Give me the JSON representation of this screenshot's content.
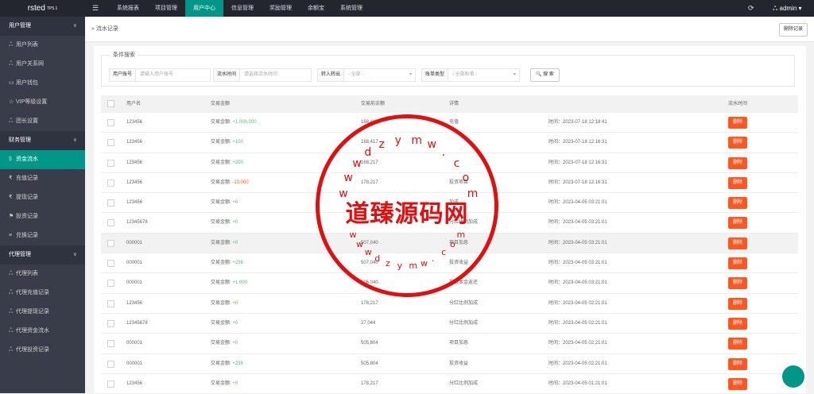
{
  "header": {
    "brand": "rsted",
    "brand_sup": "TP5.1",
    "menu_icon": "☰",
    "nav": [
      "系统报表",
      "项目管理",
      "用户中心",
      "信息管理",
      "奖励管理",
      "余额宝",
      "系统管理"
    ],
    "active_nav": "用户中心",
    "refresh_icon": "⟳",
    "user": "ஃ admin ▾"
  },
  "sidebar": {
    "groups": [
      {
        "title": "用户管理",
        "items": [
          {
            "icon": "ஃ",
            "label": "用户列表"
          },
          {
            "icon": "ஃ",
            "label": "用户关系网"
          },
          {
            "icon": "▭",
            "label": "用户钱包"
          },
          {
            "icon": "☆",
            "label": "VIP等级设置"
          },
          {
            "icon": "ஃ",
            "label": "团长设置"
          }
        ]
      },
      {
        "title": "财务管理",
        "items": [
          {
            "icon": "$",
            "label": "资金流水"
          },
          {
            "icon": "₹",
            "label": "充值记录"
          },
          {
            "icon": "₹",
            "label": "提现记录"
          },
          {
            "icon": "⚑",
            "label": "投资记录"
          },
          {
            "icon": "≡",
            "label": "兑换记录"
          }
        ]
      },
      {
        "title": "代理管理",
        "items": [
          {
            "icon": "ஃ",
            "label": "代理列表"
          },
          {
            "icon": "ஃ",
            "label": "代理充值记录"
          },
          {
            "icon": "ஃ",
            "label": "代理提现记录"
          },
          {
            "icon": "ஃ",
            "label": "代理资金流水"
          },
          {
            "icon": "ஃ",
            "label": "代理投资记录"
          }
        ]
      }
    ],
    "chevron": "∨",
    "active_item": "资金流水"
  },
  "tab": {
    "breadcrumb": "» 流水记录",
    "delete_label": "删除记录"
  },
  "filter": {
    "legend": "条件搜索",
    "fields": [
      {
        "label": "用户账号",
        "placeholder": "请输入用户账号"
      },
      {
        "label": "流水时间",
        "placeholder": "请选择流水时间"
      },
      {
        "label": "转入转出",
        "placeholder": "- 全部 -"
      },
      {
        "label": "账单类型",
        "placeholder": "- 全部账单 -"
      }
    ],
    "dropdown_icon": "▾",
    "search_label": "🔍 搜 索"
  },
  "table": {
    "headers": [
      "用户名",
      "交易金额",
      "交易前余额",
      "详情",
      "流水时间"
    ],
    "delete_label": "删除",
    "rows": [
      {
        "user": "123456",
        "prefix": "交易金额:",
        "amount": "+1,000,000",
        "before": "168,417",
        "detail": "充值",
        "time": "时间：2023-07-18 12:18:41",
        "has_delete": true,
        "neg": false
      },
      {
        "user": "123456",
        "prefix": "交易金额:",
        "amount": "+100",
        "before": "168,417",
        "detail": "",
        "time": "时间：2023-07-18 12:16:31",
        "has_delete": true,
        "neg": false
      },
      {
        "user": "123456",
        "prefix": "交易金额:",
        "amount": "+200",
        "before": "168,217",
        "detail": "",
        "time": "时间：2023-07-18 12:16:31",
        "has_delete": true,
        "neg": false
      },
      {
        "user": "123456",
        "prefix": "交易金额:",
        "amount": "-10,000",
        "before": "178,217",
        "detail": "投资项目",
        "time": "时间：2023-07-18 12:16:31",
        "has_delete": true,
        "neg": true
      },
      {
        "user": "123456",
        "prefix": "交易金额:",
        "amount": "+0",
        "before": "",
        "detail": "加成",
        "time": "时间：2023-04-05 03:21:01",
        "has_delete": true,
        "neg": false
      },
      {
        "user": "12345678",
        "prefix": "交易金额:",
        "amount": "+0",
        "before": "27,044",
        "detail": "分红比例加成",
        "time": "时间：2023-04-05 03:21:01",
        "has_delete": true,
        "neg": false
      },
      {
        "user": "000001",
        "prefix": "交易金额:",
        "amount": "+0",
        "before": "507,040",
        "detail": "项目加息",
        "time": "时间：2023-04-05 03:21:01",
        "has_delete": true,
        "neg": false
      },
      {
        "user": "000001",
        "prefix": "交易金额:",
        "amount": "+236",
        "before": "507,040",
        "detail": "投资收益",
        "time": "时间：2023-04-05 03:21:01",
        "has_delete": true,
        "neg": false
      },
      {
        "user": "000001",
        "prefix": "交易金额:",
        "amount": "+1,000",
        "before": "506,040",
        "detail": "投资本金返还",
        "time": "时间：2023-04-05 03:21:01",
        "has_delete": true,
        "neg": false
      },
      {
        "user": "123456",
        "prefix": "交易金额:",
        "amount": "+0",
        "before": "178,217",
        "detail": "分红比例加成",
        "time": "时间：2023-04-05 02:21:01",
        "has_delete": true,
        "neg": false
      },
      {
        "user": "12345678",
        "prefix": "交易金额:",
        "amount": "+0",
        "before": "27,044",
        "detail": "分红比例加成",
        "time": "时间：2023-04-05 02:21:01",
        "has_delete": true,
        "neg": false
      },
      {
        "user": "000001",
        "prefix": "交易金额:",
        "amount": "+0",
        "before": "505,804",
        "detail": "项目加息",
        "time": "时间：2023-04-05 02:21:01",
        "has_delete": true,
        "neg": false
      },
      {
        "user": "000001",
        "prefix": "交易金额:",
        "amount": "+236",
        "before": "505,804",
        "detail": "投资收益",
        "time": "时间：2023-04-05 02:21:01",
        "has_delete": true,
        "neg": false
      },
      {
        "user": "123456",
        "prefix": "交易金额:",
        "amount": "+0",
        "before": "178,217",
        "detail": "分红比例加成",
        "time": "时间：2023-04-05 01:21:01",
        "has_delete": true,
        "neg": false
      }
    ]
  },
  "watermark": {
    "center": "道臻源码网",
    "arc_top": [
      "w",
      "w",
      "w",
      "d",
      "z",
      "y",
      "m",
      "w",
      ".",
      "c",
      "o",
      "m"
    ],
    "arc_bottom": [
      "w",
      "w",
      "w",
      "d",
      "z",
      "y",
      "m",
      "w",
      ".",
      "c",
      "o",
      "m"
    ]
  }
}
